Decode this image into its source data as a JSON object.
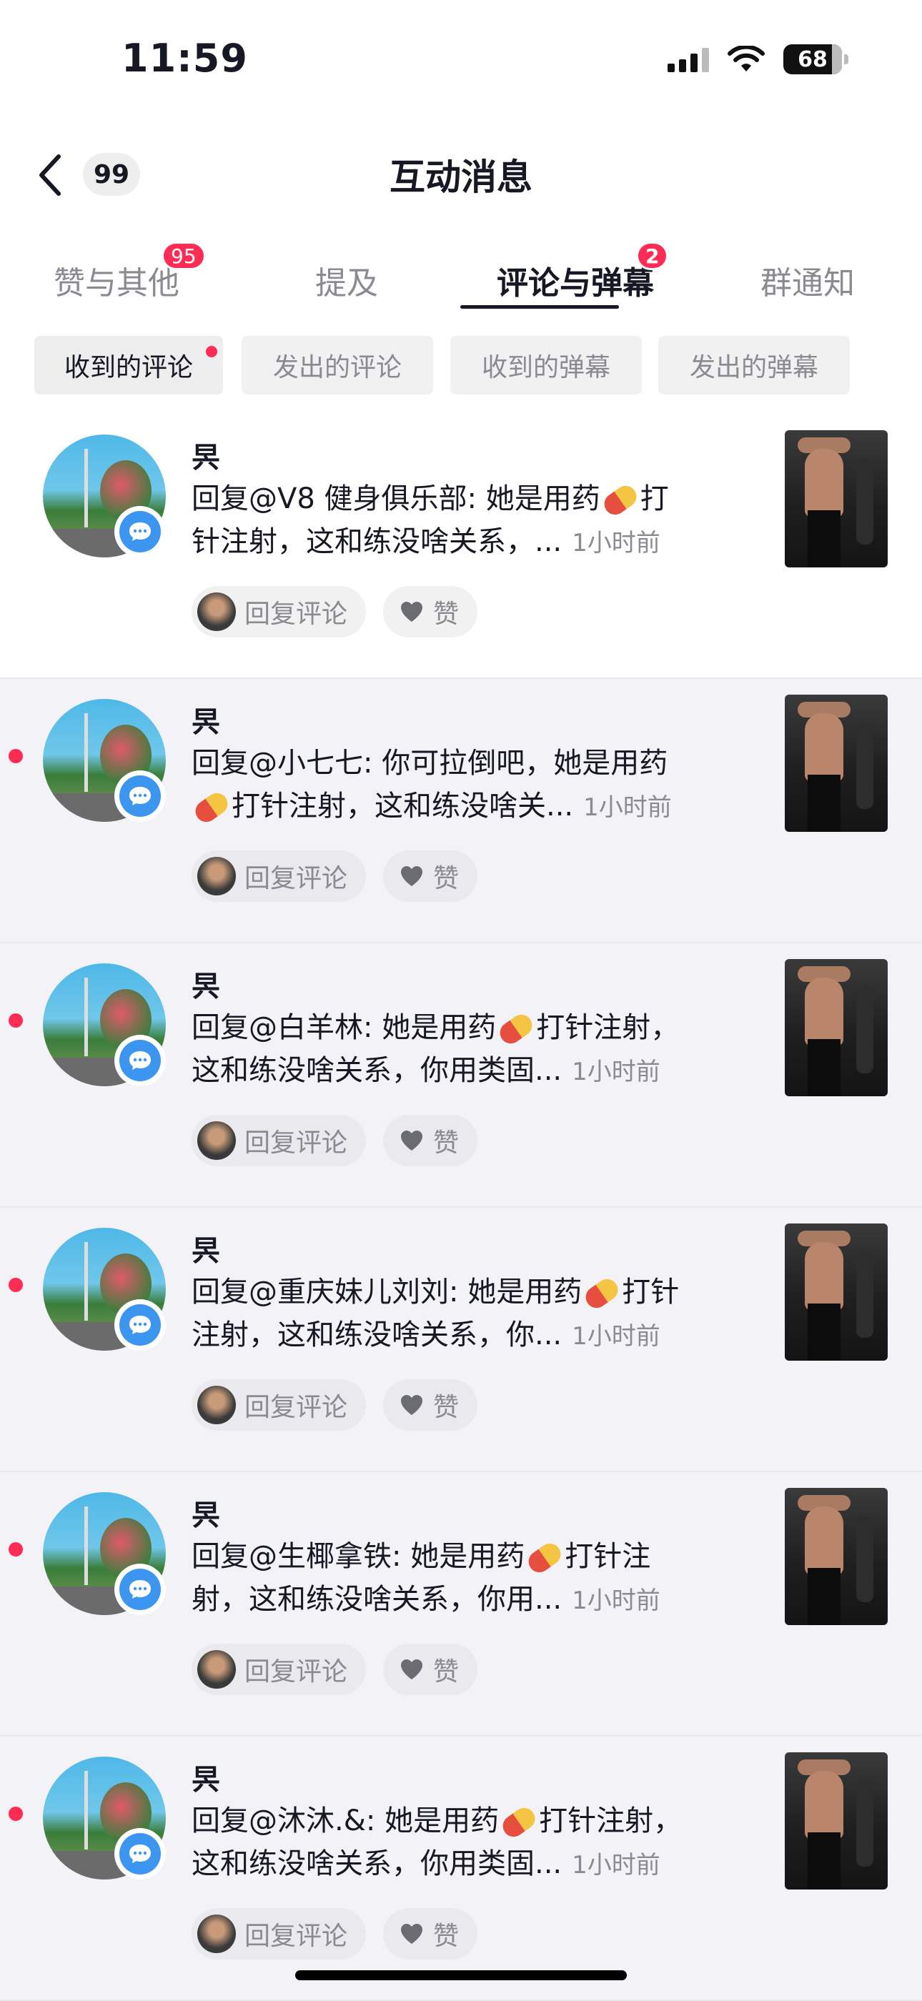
{
  "status_bar": {
    "time": "11:59",
    "battery": "68"
  },
  "nav": {
    "title": "互动消息",
    "back_count": "99"
  },
  "tabs": [
    {
      "label": "赞与其他",
      "badge": "95"
    },
    {
      "label": "提及",
      "badge": ""
    },
    {
      "label": "评论与弹幕",
      "badge": "2",
      "active": true
    },
    {
      "label": "群通知",
      "badge": ""
    }
  ],
  "filters": [
    {
      "label": "收到的评论",
      "active": true,
      "dot": true
    },
    {
      "label": "发出的评论"
    },
    {
      "label": "收到的弹幕"
    },
    {
      "label": "发出的弹幕"
    }
  ],
  "actions": {
    "reply": "回复评论",
    "like": "赞"
  },
  "notifications": [
    {
      "username": "昗",
      "line1_pre": "回复@V8  健身俱乐部: 她是用药",
      "line1_post": "打",
      "line2": "针注射，这和练没啥关系，...",
      "time": "1小时前",
      "unread": false
    },
    {
      "username": "昗",
      "line1_pre": "回复@小七七: 你可拉倒吧，她是用药",
      "line1_post": "",
      "line2_pre_emoji": true,
      "line2": "打针注射，这和练没啥关...",
      "time": "1小时前",
      "unread": true
    },
    {
      "username": "昗",
      "line1_pre": "回复@白羊林: 她是用药",
      "line1_post": "打针注射，",
      "line2": "这和练没啥关系，你用类固...",
      "time": "1小时前",
      "unread": true
    },
    {
      "username": "昗",
      "line1_pre": "回复@重庆妹儿刘刘: 她是用药",
      "line1_post": "打针",
      "line2": "注射，这和练没啥关系，你...",
      "time": "1小时前",
      "unread": true
    },
    {
      "username": "昗",
      "line1_pre": "回复@生椰拿铁: 她是用药",
      "line1_post": "打针注",
      "line2": "射，这和练没啥关系，你用...",
      "time": "1小时前",
      "unread": true
    },
    {
      "username": "昗",
      "line1_pre": "回复@沐沐.&: 她是用药",
      "line1_post": "打针注射，",
      "line2": "这和练没啥关系，你用类固...",
      "time": "1小时前",
      "unread": true
    }
  ],
  "colors": {
    "accent": "#fe2c55",
    "comment_badge": "#3c96f0",
    "background": "#f2f2f7"
  }
}
